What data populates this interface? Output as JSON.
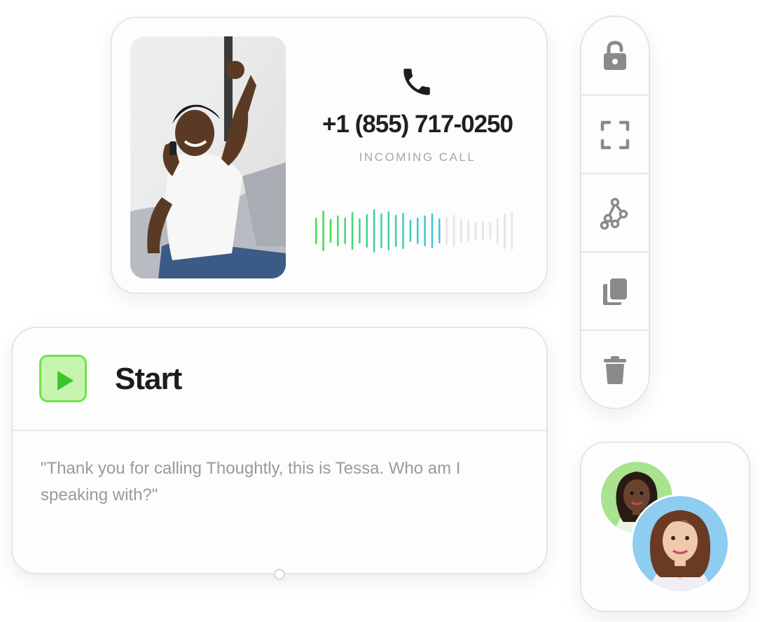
{
  "call_card": {
    "phone_number": "+1 (855) 717-0250",
    "status": "INCOMING CALL",
    "photo_icon": "caller-photo",
    "phone_icon": "phone-icon",
    "waveform_colors": {
      "active_start": "#3fdc46",
      "active_end": "#3dc5e6",
      "inactive": "#e3e3e3"
    }
  },
  "start_node": {
    "title": "Start",
    "icon": "play-icon",
    "accent": "#6fe34a",
    "script": "\"Thank you for calling Thoughtly, this is Tessa. Who am I speaking with?\""
  },
  "toolbar": {
    "items": [
      {
        "icon": "unlock-icon"
      },
      {
        "icon": "fullscreen-icon"
      },
      {
        "icon": "workflow-icon"
      },
      {
        "icon": "copy-icon"
      },
      {
        "icon": "trash-icon"
      }
    ]
  },
  "avatars": {
    "items": [
      {
        "icon": "agent-avatar"
      },
      {
        "icon": "agent-avatar"
      }
    ]
  }
}
